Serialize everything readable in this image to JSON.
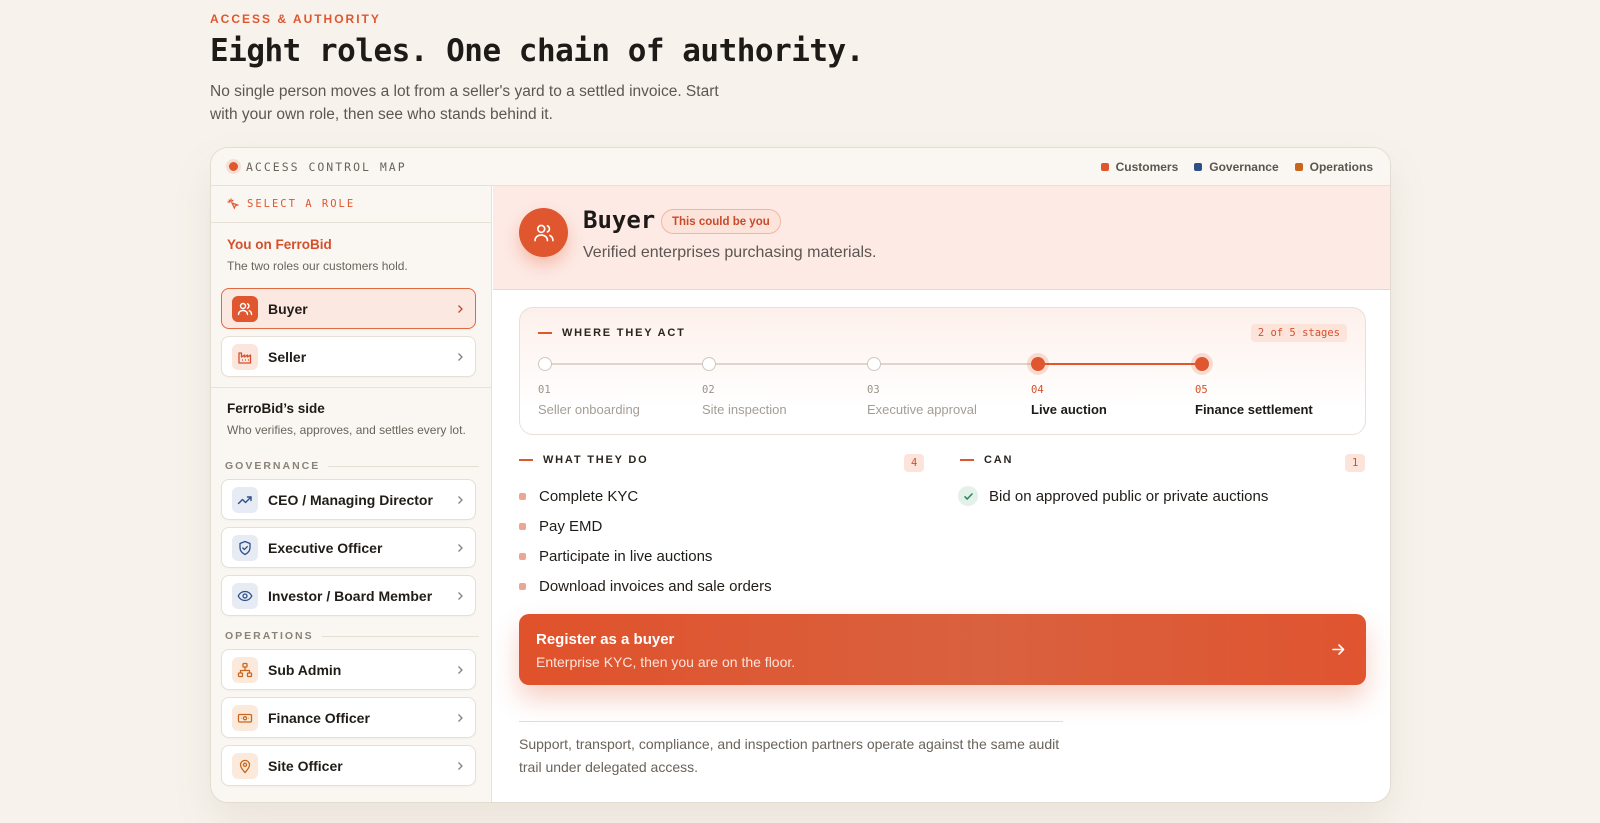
{
  "page": {
    "eyebrow": "ACCESS & AUTHORITY",
    "headline": "Eight roles. One chain of authority.",
    "lede": "No single person moves a lot from a seller's yard to a settled invoice. Start with your own role, then see who stands behind it."
  },
  "map": {
    "title": "ACCESS CONTROL MAP",
    "legend": [
      {
        "label": "Customers",
        "color": "#e0562f"
      },
      {
        "label": "Governance",
        "color": "#2f4f8a"
      },
      {
        "label": "Operations",
        "color": "#c9661c"
      }
    ]
  },
  "sidebar": {
    "select_label": "SELECT A ROLE",
    "customers_title": "You on FerroBid",
    "customers_sub": "The two roles our customers hold.",
    "customer_roles": [
      {
        "label": "Buyer",
        "icon": "users-icon",
        "active": true
      },
      {
        "label": "Seller",
        "icon": "factory-icon",
        "active": false
      }
    ],
    "ferrobid_title": "FerroBid’s side",
    "ferrobid_sub": "Who verifies, approves, and settles every lot.",
    "governance_label": "GOVERNANCE",
    "governance_roles": [
      {
        "label": "CEO / Managing Director",
        "icon": "trend-up-icon"
      },
      {
        "label": "Executive Officer",
        "icon": "shield-check-icon"
      },
      {
        "label": "Investor / Board Member",
        "icon": "eye-icon"
      }
    ],
    "operations_label": "OPERATIONS",
    "operations_roles": [
      {
        "label": "Sub Admin",
        "icon": "org-chart-icon"
      },
      {
        "label": "Finance Officer",
        "icon": "banknote-icon"
      },
      {
        "label": "Site Officer",
        "icon": "map-pin-icon"
      }
    ]
  },
  "detail": {
    "name": "Buyer",
    "badge": "This could be you",
    "description": "Verified enterprises purchasing materials.",
    "where_title": "WHERE THEY ACT",
    "where_count": "2 of 5 stages",
    "stages": [
      {
        "num": "01",
        "label": "Seller onboarding",
        "active": false
      },
      {
        "num": "02",
        "label": "Site inspection",
        "active": false
      },
      {
        "num": "03",
        "label": "Executive approval",
        "active": false
      },
      {
        "num": "04",
        "label": "Live auction",
        "active": true
      },
      {
        "num": "05",
        "label": "Finance settlement",
        "active": true
      }
    ],
    "do_title": "WHAT THEY DO",
    "do_count": "4",
    "do_items": [
      "Complete KYC",
      "Pay EMD",
      "Participate in live auctions",
      "Download invoices and sale orders"
    ],
    "can_title": "CAN",
    "can_count": "1",
    "can_items": [
      "Bid on approved public or private auctions"
    ],
    "cta_title": "Register as a buyer",
    "cta_sub": "Enterprise KYC, then you are on the floor.",
    "footnote": "Support, transport, compliance, and inspection partners operate against the same audit trail under delegated access."
  }
}
